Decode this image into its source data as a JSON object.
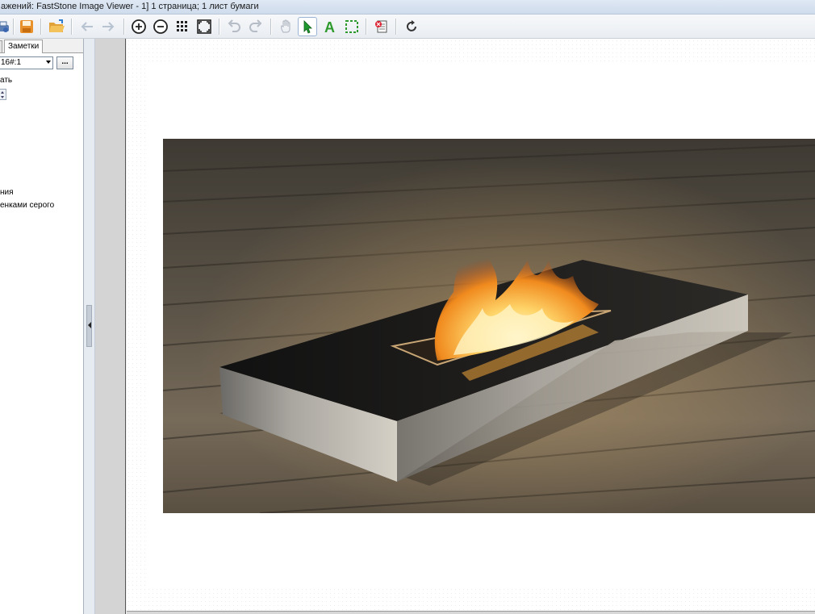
{
  "window": {
    "title": "ажений: FastStone Image Viewer - 1] 1 страница; 1 лист бумаги"
  },
  "toolbar": {
    "buttons": [
      {
        "name": "print-icon"
      },
      {
        "name": "save-icon"
      },
      {
        "name": "open-folder-icon"
      },
      {
        "name": "back-arrow-icon"
      },
      {
        "name": "forward-arrow-icon"
      },
      {
        "name": "zoom-in-icon"
      },
      {
        "name": "zoom-out-icon"
      },
      {
        "name": "grid-icon"
      },
      {
        "name": "fit-window-icon"
      },
      {
        "name": "undo-icon"
      },
      {
        "name": "redo-icon"
      },
      {
        "name": "hand-icon"
      },
      {
        "name": "pointer-icon"
      },
      {
        "name": "text-icon"
      },
      {
        "name": "select-rect-icon"
      },
      {
        "name": "delete-page-icon"
      },
      {
        "name": "refresh-icon"
      }
    ],
    "accent_color": "#2e9a2e"
  },
  "left_panel": {
    "tab_label": "Заметки",
    "combo_value": "16#:1",
    "dots_label": "...",
    "lines": [
      "ать",
      "ния",
      "енками серого"
    ]
  },
  "preview": {
    "image_description_icon": "fireplace-photo"
  }
}
